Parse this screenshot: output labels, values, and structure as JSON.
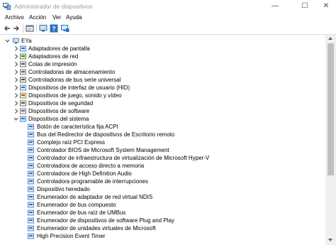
{
  "window": {
    "title": "Administrador de dispositivos",
    "minimize_glyph": "—",
    "maximize_glyph": "☐",
    "close_glyph": "✕"
  },
  "menu": [
    "Archivo",
    "Acción",
    "Ver",
    "Ayuda"
  ],
  "toolbar": [
    "back-arrow-icon",
    "forward-arrow-icon",
    "properties-icon",
    "computer-icon",
    "help-icon",
    "monitor-icon"
  ],
  "tree": {
    "root": "EYa",
    "categories": [
      {
        "label": "Adaptadores de pantalla",
        "icon": "display-adapter-icon"
      },
      {
        "label": "Adaptadores de red",
        "icon": "network-adapter-icon"
      },
      {
        "label": "Colas de impresión",
        "icon": "print-queue-icon"
      },
      {
        "label": "Controladoras de almacenamiento",
        "icon": "storage-controller-icon"
      },
      {
        "label": "Controladoras de bus serie universal",
        "icon": "usb-icon"
      },
      {
        "label": "Dispositivos de interfaz de usuario (HID)",
        "icon": "hid-icon"
      },
      {
        "label": "Dispositivos de juego, sonido y vídeo",
        "icon": "sound-icon"
      },
      {
        "label": "Dispositivos de seguridad",
        "icon": "security-device-icon"
      },
      {
        "label": "Dispositivos de software",
        "icon": "software-device-icon"
      }
    ],
    "expanded": {
      "label": "Dispositivos del sistema",
      "icon": "system-devices-icon",
      "children": [
        "Botón de característica fija ACPI",
        "Bus del Redirector de dispositivos de Escritorio remoto",
        "Complejo raíz PCI Express",
        "Controlador BIOS de Microsoft System Management",
        "Controlador de infraestructura de virtualización de Microsoft Hyper-V",
        "Controladora de acceso directo a memoria",
        "Controladora de High Definition Audio",
        "Controladora programable de interrupciones",
        "Dispositivo heredado",
        "Enumerador de adaptador de red virtual NDIS",
        "Enumerador de bus compuesto",
        "Enumerador de bus raíz de UMBus",
        "Enumerador de dispositivos de software Plug and Play",
        "Enumerador de unidades virtuales de Microsoft",
        "High Precision Event Timer"
      ]
    }
  },
  "colors": {
    "accent": "#2c6fbf",
    "title_text": "#9a9a9a",
    "chevron": "#404040",
    "scroll_track": "#f0f0f0",
    "scroll_thumb": "#c0c0c0"
  }
}
